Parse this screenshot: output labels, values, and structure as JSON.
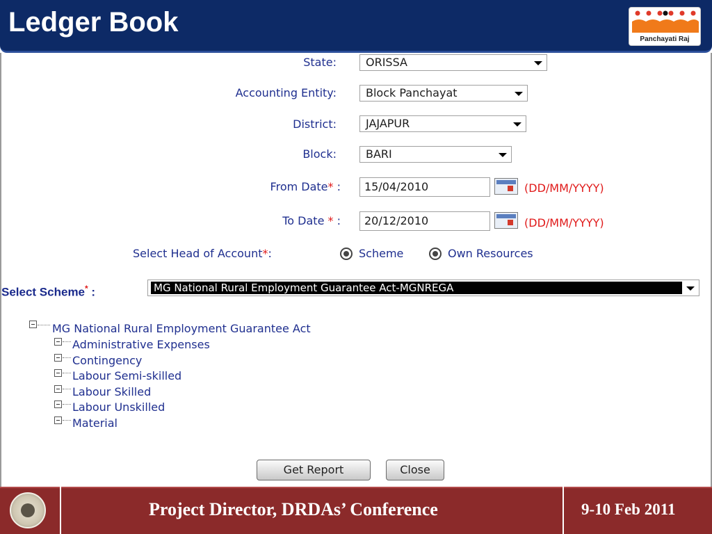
{
  "header": {
    "title": "Ledger Book",
    "logo_text": "Panchayati Raj"
  },
  "form": {
    "state": {
      "label": "State:",
      "value": "ORISSA"
    },
    "accounting_entity": {
      "label": "Accounting Entity:",
      "value": "Block Panchayat"
    },
    "district": {
      "label": "District:",
      "value": "JAJAPUR"
    },
    "block": {
      "label": "Block:",
      "value": "BARI"
    },
    "from_date": {
      "label": "From Date",
      "req": "*",
      "colon": ":",
      "value": "15/04/2010",
      "format": "(DD/MM/YYYY)"
    },
    "to_date": {
      "label": "To Date",
      "req": "*",
      "colon": ":",
      "value": "20/12/2010",
      "format": "(DD/MM/YYYY)"
    },
    "head_of_account": {
      "label": "Select Head of Account",
      "req": "*",
      "colon": ":",
      "options": [
        "Scheme",
        "Own Resources"
      ],
      "selected": "Scheme"
    },
    "scheme": {
      "label": "Select Scheme",
      "req": "*",
      "colon": ":",
      "value": "MG National Rural Employment Guarantee Act-MGNREGA"
    }
  },
  "tree": {
    "root": "MG National Rural Employment Guarantee Act",
    "children": [
      "Administrative Expenses",
      "Contingency",
      "Labour Semi-skilled",
      "Labour Skilled",
      "Labour Unskilled",
      "Material"
    ]
  },
  "buttons": {
    "get_report": "Get Report",
    "close": "Close"
  },
  "footer": {
    "title": "Project Director, DRDAs’ Conference",
    "date": "9-10 Feb 2011"
  },
  "colors": {
    "header_bg": "#0d2a66",
    "footer_bg": "#8b2a2a",
    "label": "#1f2f8f",
    "required": "#e01a1a"
  }
}
